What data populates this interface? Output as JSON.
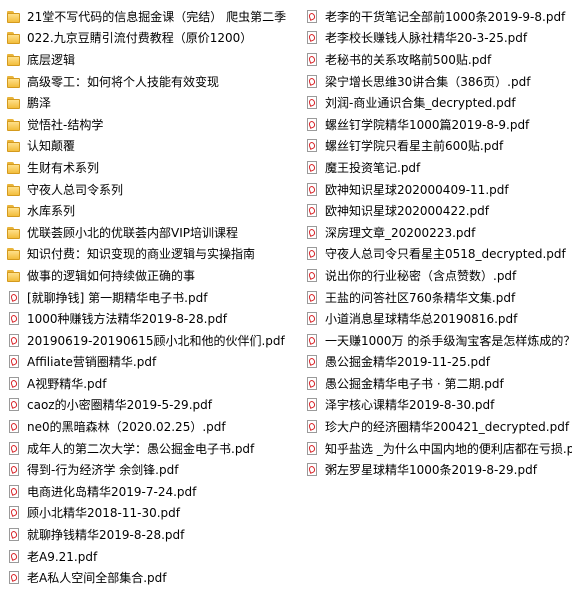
{
  "left_column": [
    {
      "type": "folder-icon",
      "name": "21堂不写代码的信息掘金课（完结） 爬虫第二季"
    },
    {
      "type": "folder-icon",
      "name": "022.九京豆䝼引流付费教程（原价1200）"
    },
    {
      "type": "folder-icon",
      "name": "底层逻辑"
    },
    {
      "type": "folder-icon",
      "name": "高级零工：如何将个人技能有效变现"
    },
    {
      "type": "folder-icon",
      "name": "鹏泽"
    },
    {
      "type": "folder-icon",
      "name": "觉悟社-结构学"
    },
    {
      "type": "folder-icon",
      "name": "认知颠覆"
    },
    {
      "type": "folder-icon",
      "name": "生财有术系列"
    },
    {
      "type": "folder-icon",
      "name": "守夜人总司令系列"
    },
    {
      "type": "folder-icon",
      "name": "水库系列"
    },
    {
      "type": "folder-icon",
      "name": "优联荟顾小北的优联荟内部VIP培训课程"
    },
    {
      "type": "folder-icon",
      "name": "知识付费：知识变现的商业逻辑与实操指南"
    },
    {
      "type": "folder-icon",
      "name": "做事的逻辑如何持续做正确的事"
    },
    {
      "type": "pdf-icon",
      "name": "[就聊挣钱] 第一期精华电子书.pdf"
    },
    {
      "type": "pdf-icon",
      "name": "1000种赚钱方法精华2019-8-28.pdf"
    },
    {
      "type": "pdf-icon",
      "name": "20190619-20190615顾小北和他的伙伴们.pdf"
    },
    {
      "type": "pdf-icon",
      "name": "Affiliate营销圈精华.pdf"
    },
    {
      "type": "pdf-icon",
      "name": "A视野精华.pdf"
    },
    {
      "type": "pdf-icon",
      "name": "caoz的小密圈精华2019-5-29.pdf"
    },
    {
      "type": "pdf-icon",
      "name": "ne0的黑暗森林（2020.02.25）.pdf"
    },
    {
      "type": "pdf-icon",
      "name": "成年人的第二次大学：愚公掘金电子书.pdf"
    },
    {
      "type": "pdf-icon",
      "name": "得到-行为经济学 余剑锋.pdf"
    },
    {
      "type": "pdf-icon",
      "name": "电商进化岛精华2019-7-24.pdf"
    },
    {
      "type": "pdf-icon",
      "name": "顾小北精华2018-11-30.pdf"
    },
    {
      "type": "pdf-icon",
      "name": "就聊挣钱精华2019-8-28.pdf"
    },
    {
      "type": "pdf-icon",
      "name": "老A9.21.pdf"
    },
    {
      "type": "pdf-icon",
      "name": "老A私人空间全部集合.pdf"
    }
  ],
  "right_column": [
    {
      "type": "pdf-icon",
      "name": "老李的干货笔记全部前1000条2019-9-8.pdf"
    },
    {
      "type": "pdf-icon",
      "name": "老李校长赚钱人脉社精华20-3-25.pdf"
    },
    {
      "type": "pdf-icon",
      "name": "老秘书的关系攻略前500贴.pdf"
    },
    {
      "type": "pdf-icon",
      "name": "梁宁增长思维30讲合集（386页）.pdf"
    },
    {
      "type": "pdf-icon",
      "name": "刘润-商业通识合集_decrypted.pdf"
    },
    {
      "type": "pdf-icon",
      "name": "螺丝钉学院精华1000篇2019-8-9.pdf"
    },
    {
      "type": "pdf-icon",
      "name": "螺丝钉学院只看星主前600贴.pdf"
    },
    {
      "type": "pdf-icon",
      "name": "魔王投资笔记.pdf"
    },
    {
      "type": "pdf-icon",
      "name": "欧神知识星球202000409-11.pdf"
    },
    {
      "type": "pdf-icon",
      "name": "欧神知识星球202000422.pdf"
    },
    {
      "type": "pdf-icon",
      "name": "深房理文章_20200223.pdf"
    },
    {
      "type": "pdf-icon",
      "name": "守夜人总司令只看星主0518_decrypted.pdf"
    },
    {
      "type": "pdf-icon",
      "name": "说出你的行业秘密（含点赞数）.pdf"
    },
    {
      "type": "pdf-icon",
      "name": "王盐的问答社区760条精华文集.pdf"
    },
    {
      "type": "pdf-icon",
      "name": "小道消息星球精华总20190816.pdf"
    },
    {
      "type": "pdf-icon",
      "name": "一天赚1000万 的杀手级淘宝客是怎样炼成的？"
    },
    {
      "type": "pdf-icon",
      "name": "愚公掘金精华2019-11-25.pdf"
    },
    {
      "type": "pdf-icon",
      "name": "愚公掘金精华电子书 · 第二期.pdf"
    },
    {
      "type": "pdf-icon",
      "name": "泽宇核心课精华2019-8-30.pdf"
    },
    {
      "type": "pdf-icon",
      "name": "珍大户的经济圈精华200421_decrypted.pdf"
    },
    {
      "type": "pdf-icon",
      "name": "知乎盐选 _为什么中国内地的便利店都在亏损.p"
    },
    {
      "type": "pdf-icon",
      "name": "粥左罗星球精华1000条2019-8-29.pdf"
    }
  ]
}
